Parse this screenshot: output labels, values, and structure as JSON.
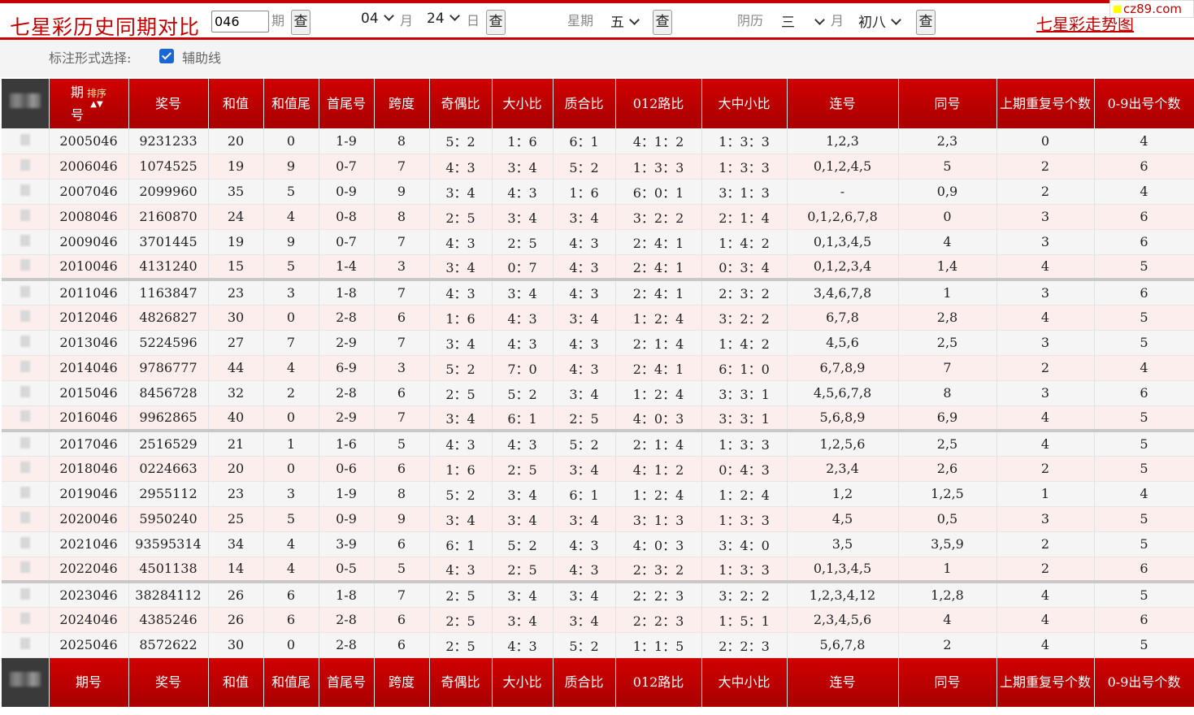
{
  "header": {
    "title": "七星彩历史同期对比",
    "period_value": "046",
    "period_label": "期",
    "query_label": "查",
    "month_value": "04",
    "month_label": "月",
    "day_value": "24",
    "day_label": "日",
    "weekday_label": "星期",
    "weekday_value": "五",
    "lunar_label": "阴历",
    "lunar_month_value": "三",
    "lunar_month_label": "月",
    "lunar_day_value": "初八",
    "trend_link": "七星彩走势图",
    "watermark": "cz89.com"
  },
  "options": {
    "label": "标注形式选择:",
    "checkbox_label": "辅助线",
    "checked": true
  },
  "table": {
    "headers": [
      "期号",
      "排序",
      "奖号",
      "和值",
      "和值尾",
      "首尾号",
      "跨度",
      "奇偶比",
      "大小比",
      "质合比",
      "012路比",
      "大中小比",
      "连号",
      "同号",
      "上期重复号个数",
      "0-9出号个数"
    ],
    "footer_headers": [
      "期号",
      "奖号",
      "和值",
      "和值尾",
      "首尾号",
      "跨度",
      "奇偶比",
      "大小比",
      "质合比",
      "012路比",
      "大中小比",
      "连号",
      "同号",
      "上期重复号个数",
      "0-9出号个数"
    ],
    "rows": [
      [
        "2005046",
        "9231233",
        "20",
        "0",
        "1-9",
        "8",
        "5：2",
        "1：6",
        "6：1",
        "4：1：2",
        "1：3：3",
        "1,2,3",
        "2,3",
        "0",
        "4"
      ],
      [
        "2006046",
        "1074525",
        "19",
        "9",
        "0-7",
        "7",
        "4：3",
        "3：4",
        "5：2",
        "1：3：3",
        "1：3：3",
        "0,1,2,4,5",
        "5",
        "2",
        "6"
      ],
      [
        "2007046",
        "2099960",
        "35",
        "5",
        "0-9",
        "9",
        "3：4",
        "4：3",
        "1：6",
        "6：0：1",
        "3：1：3",
        "-",
        "0,9",
        "2",
        "4"
      ],
      [
        "2008046",
        "2160870",
        "24",
        "4",
        "0-8",
        "8",
        "2：5",
        "3：4",
        "3：4",
        "3：2：2",
        "2：1：4",
        "0,1,2,6,7,8",
        "0",
        "3",
        "6"
      ],
      [
        "2009046",
        "3701445",
        "19",
        "9",
        "0-7",
        "7",
        "4：3",
        "2：5",
        "4：3",
        "2：4：1",
        "1：4：2",
        "0,1,3,4,5",
        "4",
        "3",
        "6"
      ],
      [
        "2010046",
        "4131240",
        "15",
        "5",
        "1-4",
        "3",
        "3：4",
        "0：7",
        "4：3",
        "2：4：1",
        "0：3：4",
        "0,1,2,3,4",
        "1,4",
        "4",
        "5"
      ],
      [
        "2011046",
        "1163847",
        "23",
        "3",
        "1-8",
        "7",
        "4：3",
        "3：4",
        "4：3",
        "2：4：1",
        "2：3：2",
        "3,4,6,7,8",
        "1",
        "3",
        "6"
      ],
      [
        "2012046",
        "4826827",
        "30",
        "0",
        "2-8",
        "6",
        "1：6",
        "4：3",
        "3：4",
        "1：2：4",
        "3：2：2",
        "6,7,8",
        "2,8",
        "4",
        "5"
      ],
      [
        "2013046",
        "5224596",
        "27",
        "7",
        "2-9",
        "7",
        "3：4",
        "4：3",
        "4：3",
        "2：1：4",
        "1：4：2",
        "4,5,6",
        "2,5",
        "3",
        "5"
      ],
      [
        "2014046",
        "9786777",
        "44",
        "4",
        "6-9",
        "3",
        "5：2",
        "7：0",
        "4：3",
        "2：4：1",
        "6：1：0",
        "6,7,8,9",
        "7",
        "2",
        "4"
      ],
      [
        "2015046",
        "8456728",
        "32",
        "2",
        "2-8",
        "6",
        "2：5",
        "5：2",
        "3：4",
        "1：2：4",
        "3：3：1",
        "4,5,6,7,8",
        "8",
        "3",
        "6"
      ],
      [
        "2016046",
        "9962865",
        "40",
        "0",
        "2-9",
        "7",
        "3：4",
        "6：1",
        "2：5",
        "4：0：3",
        "3：3：1",
        "5,6,8,9",
        "6,9",
        "4",
        "5"
      ],
      [
        "2017046",
        "2516529",
        "21",
        "1",
        "1-6",
        "5",
        "4：3",
        "4：3",
        "5：2",
        "2：1：4",
        "1：3：3",
        "1,2,5,6",
        "2,5",
        "4",
        "5"
      ],
      [
        "2018046",
        "0224663",
        "20",
        "0",
        "0-6",
        "6",
        "1：6",
        "2：5",
        "3：4",
        "4：1：2",
        "0：4：3",
        "2,3,4",
        "2,6",
        "2",
        "5"
      ],
      [
        "2019046",
        "2955112",
        "23",
        "3",
        "1-9",
        "8",
        "5：2",
        "3：4",
        "6：1",
        "1：2：4",
        "1：2：4",
        "1,2",
        "1,2,5",
        "1",
        "4"
      ],
      [
        "2020046",
        "5950240",
        "25",
        "5",
        "0-9",
        "9",
        "3：4",
        "3：4",
        "3：4",
        "3：1：3",
        "1：3：3",
        "4,5",
        "0,5",
        "3",
        "5"
      ],
      [
        "2021046",
        "93595314",
        "34",
        "4",
        "3-9",
        "6",
        "6：1",
        "5：2",
        "4：3",
        "4：0：3",
        "3：4：0",
        "3,5",
        "3,5,9",
        "2",
        "5"
      ],
      [
        "2022046",
        "4501138",
        "14",
        "4",
        "0-5",
        "5",
        "4：3",
        "2：5",
        "4：3",
        "2：3：2",
        "1：3：3",
        "0,1,3,4,5",
        "1",
        "2",
        "6"
      ],
      [
        "2023046",
        "38284112",
        "26",
        "6",
        "1-8",
        "7",
        "2：5",
        "3：4",
        "3：4",
        "2：2：3",
        "3：2：2",
        "1,2,3,4,12",
        "1,2,8",
        "4",
        "5"
      ],
      [
        "2024046",
        "4385246",
        "26",
        "6",
        "2-8",
        "6",
        "2：5",
        "3：4",
        "3：4",
        "2：2：3",
        "1：5：1",
        "2,3,4,5,6",
        "4",
        "4",
        "6"
      ],
      [
        "2025046",
        "8572622",
        "30",
        "0",
        "2-8",
        "6",
        "2：5",
        "4：3",
        "5：2",
        "1：1：5",
        "2：2：3",
        "5,6,7,8",
        "2",
        "4",
        "5"
      ]
    ]
  }
}
